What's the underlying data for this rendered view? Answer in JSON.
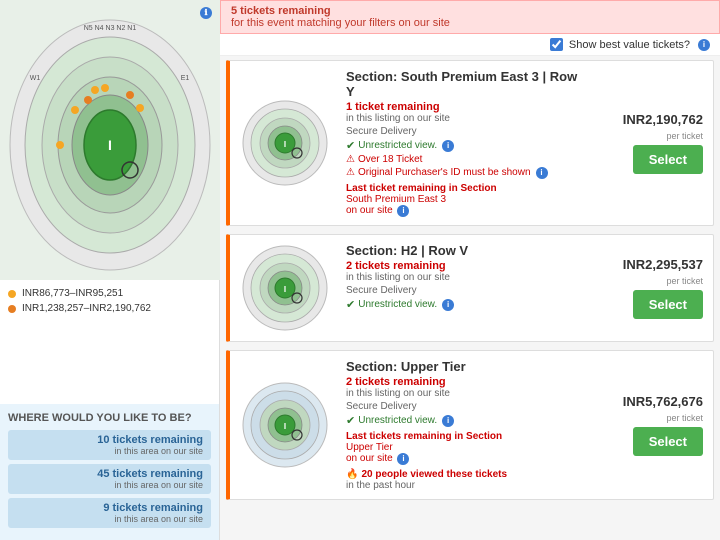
{
  "alert": {
    "bold": "5 tickets remaining",
    "sub": "for this event matching your filters on our site"
  },
  "best_value": {
    "label": "Show best value tickets?",
    "checked": true
  },
  "left_panel": {
    "info_icon": "ℹ",
    "legend": [
      {
        "color": "#f5a623",
        "label": "INR86,773–INR95,251"
      },
      {
        "color": "#e67e22",
        "label": "INR1,238,257–INR2,190,762"
      }
    ],
    "where_title": "WHERE WOULD YOU LIKE TO BE?",
    "where_items": [
      {
        "count": "10 tickets remaining",
        "sub": "in this area on our site"
      },
      {
        "count": "45 tickets remaining",
        "sub": "in this area on our site"
      },
      {
        "count": "9 tickets remaining",
        "sub": "in this area on our site"
      }
    ]
  },
  "listings": [
    {
      "title": "Section: South Premium East 3 | Row Y",
      "tickets_remaining": "1 ticket remaining",
      "in_listing": "in this listing on our site",
      "secure": "Secure Delivery",
      "unrestricted": "Unrestricted view.",
      "warnings": [
        "Over 18 Ticket",
        "Original Purchaser's ID must be shown"
      ],
      "last_ticket_msg": "Last ticket remaining in Section",
      "last_ticket_section": "South Premium East 3",
      "last_ticket_on_site": "on our site",
      "price": "INR2,190,762",
      "per_ticket": "per ticket",
      "select_label": "Select"
    },
    {
      "title": "Section: H2 | Row V",
      "tickets_remaining": "2 tickets remaining",
      "in_listing": "in this listing on our site",
      "secure": "Secure Delivery",
      "unrestricted": "Unrestricted view.",
      "warnings": [],
      "last_ticket_msg": "",
      "price": "INR2,295,537",
      "per_ticket": "per ticket",
      "select_label": "Select"
    },
    {
      "title": "Section: Upper Tier",
      "tickets_remaining": "2 tickets remaining",
      "in_listing": "in this listing on our site",
      "secure": "Secure Delivery",
      "unrestricted": "Unrestricted view.",
      "warnings": [],
      "last_ticket_msg": "Last tickets remaining in Section",
      "last_ticket_section": "Upper Tier",
      "last_ticket_on_site": "on our site",
      "price": "INR5,762,676",
      "per_ticket": "per ticket",
      "select_label": "Select",
      "viewed_msg": "20 people viewed these tickets",
      "viewed_sub": "in the past hour"
    }
  ]
}
